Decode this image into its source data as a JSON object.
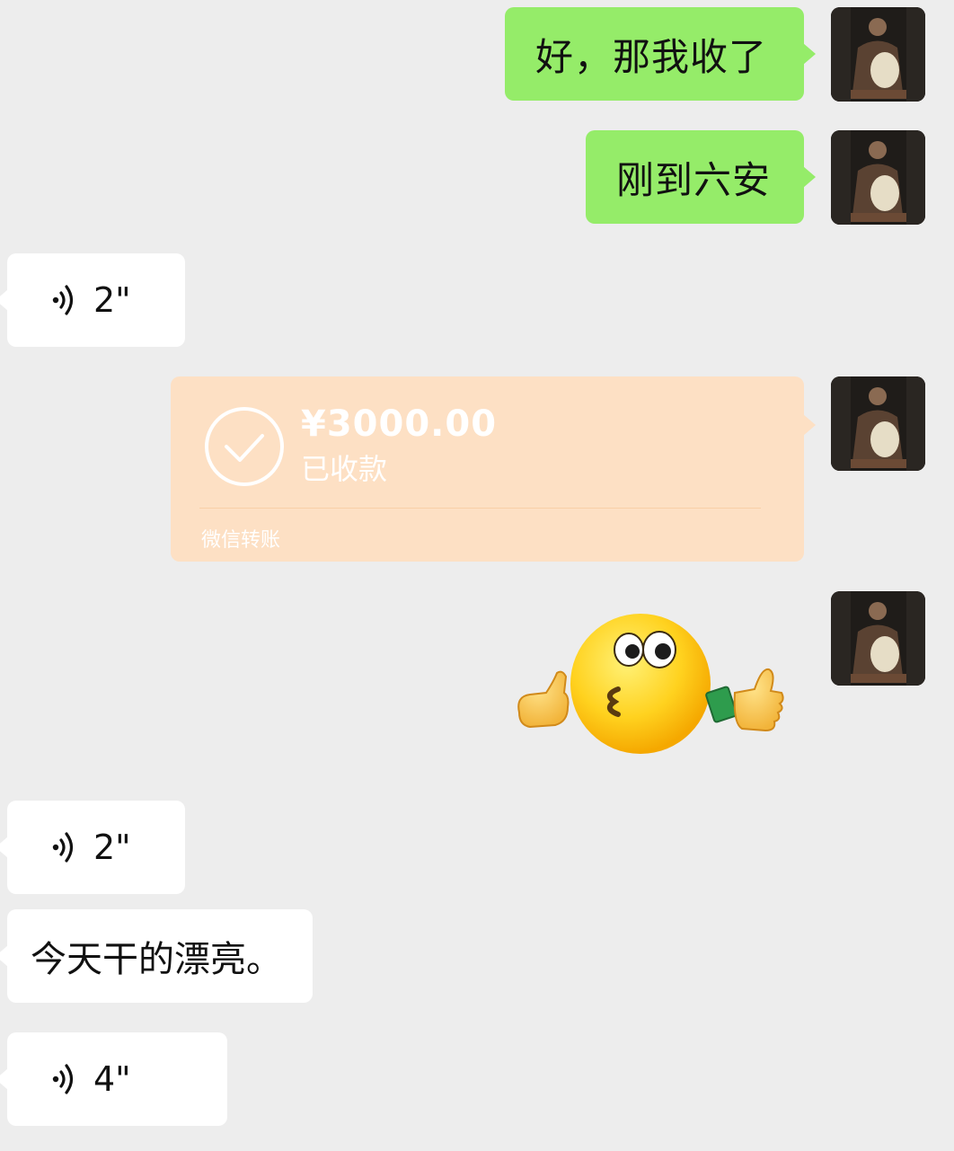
{
  "colors": {
    "background": "#ededed",
    "sent_bubble": "#95ec69",
    "received_bubble": "#ffffff",
    "transfer_card": "#fde0c4"
  },
  "messages": {
    "m1": {
      "text": "好，那我收了"
    },
    "m2": {
      "text": "刚到六安"
    },
    "m3": {
      "duration": "2\""
    },
    "transfer": {
      "amount": "¥3000.00",
      "status": "已收款",
      "footer": "微信转账"
    },
    "sticker": {
      "icon": "kiss-thumbs-up-emoji"
    },
    "m5": {
      "duration": "2\""
    },
    "m6": {
      "text": "今天干的漂亮。"
    },
    "m7": {
      "duration": "4\""
    }
  }
}
